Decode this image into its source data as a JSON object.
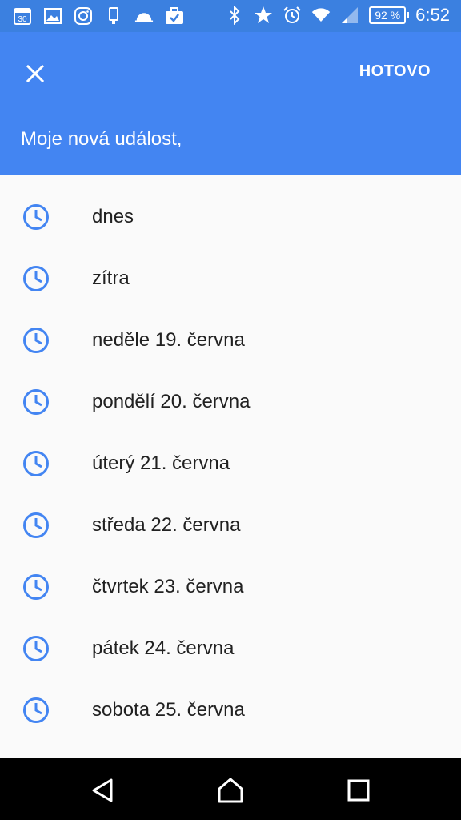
{
  "status_bar": {
    "time": "6:52",
    "battery": "92 %",
    "calendar_day": "30"
  },
  "app_bar": {
    "close_label": "✕",
    "done_label": "HOTOVO",
    "event_title": "Moje nová událost,"
  },
  "suggestions": [
    {
      "label": "dnes",
      "icon": "clock-icon"
    },
    {
      "label": "zítra",
      "icon": "clock-icon"
    },
    {
      "label": "neděle 19. června",
      "icon": "clock-icon"
    },
    {
      "label": "pondělí 20. června",
      "icon": "clock-icon"
    },
    {
      "label": "úterý 21. června",
      "icon": "clock-icon"
    },
    {
      "label": "středa 22. června",
      "icon": "clock-icon"
    },
    {
      "label": "čtvrtek 23. června",
      "icon": "clock-icon"
    },
    {
      "label": "pátek 24. června",
      "icon": "clock-icon"
    },
    {
      "label": "sobota 25. června",
      "icon": "clock-icon"
    }
  ],
  "colors": {
    "app_bar": "#4385f2",
    "status_bar": "#3b80e0",
    "accent": "#4385f2",
    "nav_bar": "#000000"
  },
  "nav": {
    "back_icon": "back-triangle-icon",
    "home_icon": "home-icon",
    "recents_icon": "recents-square-icon"
  }
}
